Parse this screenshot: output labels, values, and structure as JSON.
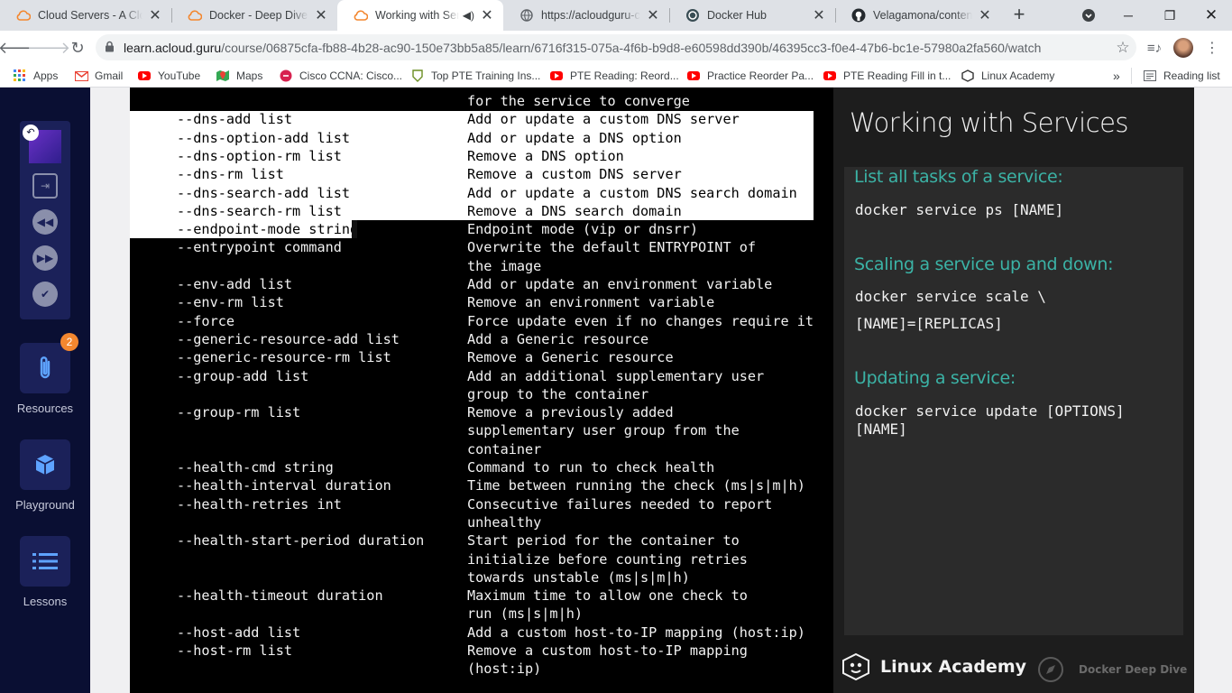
{
  "browser": {
    "tabs": [
      {
        "title": "Cloud Servers - A Cloud Guru",
        "icon": "acloudguru-icon",
        "active": false
      },
      {
        "title": "Docker - Deep Dive - A Cloud Guru",
        "icon": "acloudguru-icon",
        "active": false
      },
      {
        "title": "Working with Services",
        "icon": "acloudguru-icon",
        "active": true,
        "audio": true
      },
      {
        "title": "https://acloudguru-content",
        "icon": "globe-icon",
        "active": false
      },
      {
        "title": "Docker Hub",
        "icon": "dockerhub-icon",
        "active": false
      },
      {
        "title": "Velagamona/content-docker",
        "icon": "github-icon",
        "active": false
      }
    ],
    "url_host": "learn.acloud.guru",
    "url_path": "/course/06875cfa-fb88-4b28-ac90-150e73bb5a85/learn/6716f315-075a-4f6b-b9d8-e60598dd390b/46395cc3-f0e4-47b6-bc1e-57980a2fa560/watch",
    "bookmarks": [
      {
        "label": "Apps",
        "icon": "apps-grid-icon"
      },
      {
        "label": "Gmail",
        "icon": "gmail-icon"
      },
      {
        "label": "YouTube",
        "icon": "youtube-icon"
      },
      {
        "label": "Maps",
        "icon": "maps-icon"
      },
      {
        "label": "Cisco CCNA: Cisco...",
        "icon": "cisco-icon"
      },
      {
        "label": "Top PTE Training Ins...",
        "icon": "pte-icon"
      },
      {
        "label": "PTE Reading: Reord...",
        "icon": "youtube-icon"
      },
      {
        "label": "Practice Reorder Pa...",
        "icon": "youtube-icon"
      },
      {
        "label": "PTE Reading Fill in t...",
        "icon": "youtube-icon"
      },
      {
        "label": "Linux Academy",
        "icon": "linux-academy-icon"
      }
    ],
    "reading_list": "Reading list",
    "more": "»"
  },
  "sidebar": {
    "resources_label": "Resources",
    "resources_badge": "2",
    "playground_label": "Playground",
    "lessons_label": "Lessons"
  },
  "terminal": {
    "rows": [
      {
        "opt": "",
        "desc": "for the service to converge",
        "selected": false
      },
      {
        "opt": "--dns-add list",
        "desc": "Add or update a custom DNS server",
        "selected": true
      },
      {
        "opt": "--dns-option-add list",
        "desc": "Add or update a DNS option",
        "selected": true
      },
      {
        "opt": "--dns-option-rm list",
        "desc": "Remove a DNS option",
        "selected": true
      },
      {
        "opt": "--dns-rm list",
        "desc": "Remove a custom DNS server",
        "selected": true
      },
      {
        "opt": "--dns-search-add list",
        "desc": "Add or update a custom DNS search domain",
        "selected": true
      },
      {
        "opt": "--dns-search-rm list",
        "desc": "Remove a DNS search domain",
        "selected": true
      },
      {
        "opt": "--endpoint-mode string",
        "desc": "Endpoint mode (vip or dnsrr)",
        "selected": "partial"
      },
      {
        "opt": "--entrypoint command",
        "desc": "Overwrite the default ENTRYPOINT of",
        "selected": false
      },
      {
        "opt": "",
        "desc": "the image",
        "selected": false
      },
      {
        "opt": "--env-add list",
        "desc": "Add or update an environment variable",
        "selected": false
      },
      {
        "opt": "--env-rm list",
        "desc": "Remove an environment variable",
        "selected": false
      },
      {
        "opt": "--force",
        "desc": "Force update even if no changes require it",
        "selected": false
      },
      {
        "opt": "--generic-resource-add list",
        "desc": "Add a Generic resource",
        "selected": false
      },
      {
        "opt": "--generic-resource-rm list",
        "desc": "Remove a Generic resource",
        "selected": false
      },
      {
        "opt": "--group-add list",
        "desc": "Add an additional supplementary user",
        "selected": false
      },
      {
        "opt": "",
        "desc": "group to the container",
        "selected": false
      },
      {
        "opt": "--group-rm list",
        "desc": "Remove a previously added",
        "selected": false
      },
      {
        "opt": "",
        "desc": "supplementary user group from the",
        "selected": false
      },
      {
        "opt": "",
        "desc": "container",
        "selected": false
      },
      {
        "opt": "--health-cmd string",
        "desc": "Command to run to check health",
        "selected": false
      },
      {
        "opt": "--health-interval duration",
        "desc": "Time between running the check (ms|s|m|h)",
        "selected": false
      },
      {
        "opt": "--health-retries int",
        "desc": "Consecutive failures needed to report",
        "selected": false
      },
      {
        "opt": "",
        "desc": "unhealthy",
        "selected": false
      },
      {
        "opt": "--health-start-period duration",
        "desc": "Start period for the container to",
        "selected": false
      },
      {
        "opt": "",
        "desc": "initialize before counting retries",
        "selected": false
      },
      {
        "opt": "",
        "desc": "towards unstable (ms|s|m|h)",
        "selected": false
      },
      {
        "opt": "--health-timeout duration",
        "desc": "Maximum time to allow one check to",
        "selected": false
      },
      {
        "opt": "",
        "desc": "run (ms|s|m|h)",
        "selected": false
      },
      {
        "opt": "--host-add list",
        "desc": "Add a custom host-to-IP mapping (host:ip)",
        "selected": false
      },
      {
        "opt": "--host-rm list",
        "desc": "Remove a custom host-to-IP mapping",
        "selected": false
      },
      {
        "opt": "",
        "desc": "(host:ip)",
        "selected": false
      }
    ]
  },
  "slide": {
    "title": "Working with Services",
    "sections": [
      {
        "heading": "List all tasks of a service:",
        "code": [
          "docker service ps [NAME]"
        ]
      },
      {
        "heading": "Scaling a service up and down:",
        "code": [
          "docker service scale \\",
          "[NAME]=[REPLICAS]"
        ]
      },
      {
        "heading": "Updating a service:",
        "code": [
          "docker service update [OPTIONS]",
          "[NAME]"
        ]
      }
    ],
    "brand": "Linux Academy",
    "course_brand": "Docker Deep Dive"
  }
}
